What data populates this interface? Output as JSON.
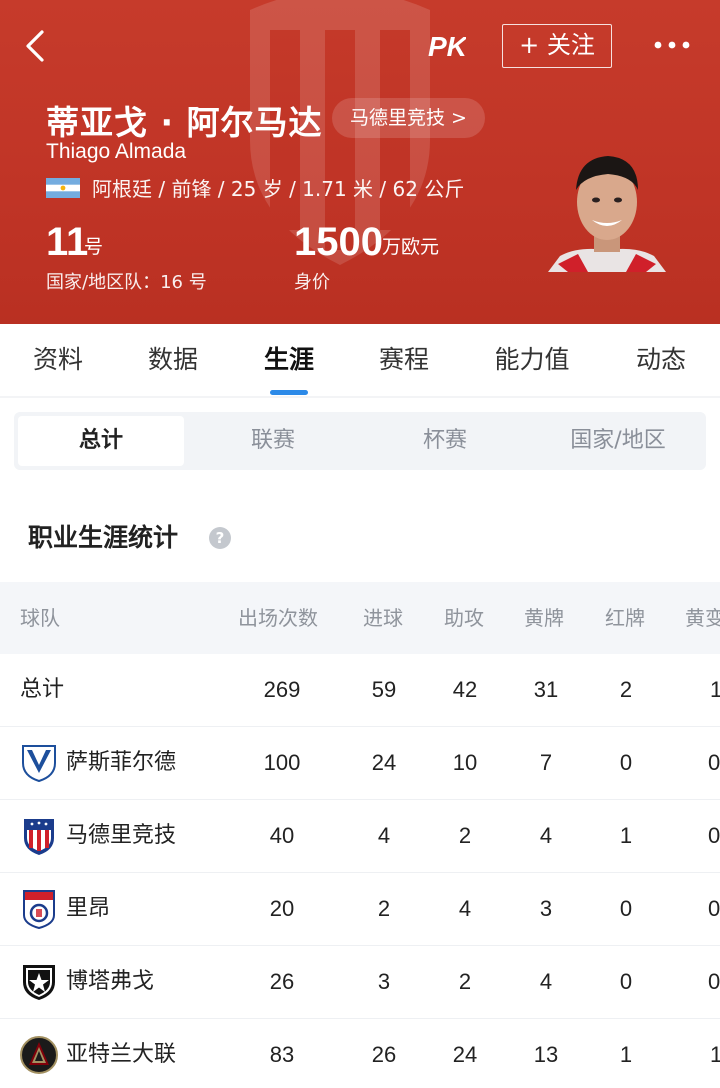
{
  "header": {
    "back_icon": "chevron-left-icon",
    "pk_logo": "PK",
    "follow_label": "+ 关注",
    "more_icon": "more-dots-icon",
    "player_name": "蒂亚戈 · 阿尔马达",
    "club_link": "马德里竞技 >",
    "player_name_latin": "Thiago Almada",
    "flag": "argentina-flag-icon",
    "info": "阿根廷 / 前锋 / 25 岁 / 1.71 米 / 62 公斤",
    "number": "11",
    "number_unit": "号",
    "national_number": "国家/地区队：16 号",
    "value": "1500",
    "value_unit": "万欧元",
    "value_label": "身价",
    "brand_color": "#c33a2a"
  },
  "tabs": [
    {
      "label": "资料"
    },
    {
      "label": "数据"
    },
    {
      "label": "生涯",
      "active": true
    },
    {
      "label": "赛程"
    },
    {
      "label": "能力值"
    },
    {
      "label": "动态"
    }
  ],
  "segments": [
    {
      "label": "总计",
      "active": true
    },
    {
      "label": "联赛"
    },
    {
      "label": "杯赛"
    },
    {
      "label": "国家/地区"
    }
  ],
  "section_title": "职业生涯统计",
  "table": {
    "columns": [
      "球队",
      "出场次数",
      "进球",
      "助攻",
      "黄牌",
      "红牌",
      "黄变"
    ],
    "rows": [
      {
        "team": "总计",
        "logo": "",
        "apps": "269",
        "goals": "59",
        "assists": "42",
        "yellow": "31",
        "red": "2",
        "yr": "1"
      },
      {
        "team": "萨斯菲尔德",
        "logo": "velez-sarsfield-logo-icon",
        "apps": "100",
        "goals": "24",
        "assists": "10",
        "yellow": "7",
        "red": "0",
        "yr": "0"
      },
      {
        "team": "马德里竞技",
        "logo": "atletico-madrid-logo-icon",
        "apps": "40",
        "goals": "4",
        "assists": "2",
        "yellow": "4",
        "red": "1",
        "yr": "0"
      },
      {
        "team": "里昂",
        "logo": "olympique-lyonnais-logo-icon",
        "apps": "20",
        "goals": "2",
        "assists": "4",
        "yellow": "3",
        "red": "0",
        "yr": "0"
      },
      {
        "team": "博塔弗戈",
        "logo": "botafogo-logo-icon",
        "apps": "26",
        "goals": "3",
        "assists": "2",
        "yellow": "4",
        "red": "0",
        "yr": "0"
      },
      {
        "team": "亚特兰大联",
        "logo": "atlanta-united-logo-icon",
        "apps": "83",
        "goals": "26",
        "assists": "24",
        "yellow": "13",
        "red": "1",
        "yr": "1"
      }
    ]
  }
}
